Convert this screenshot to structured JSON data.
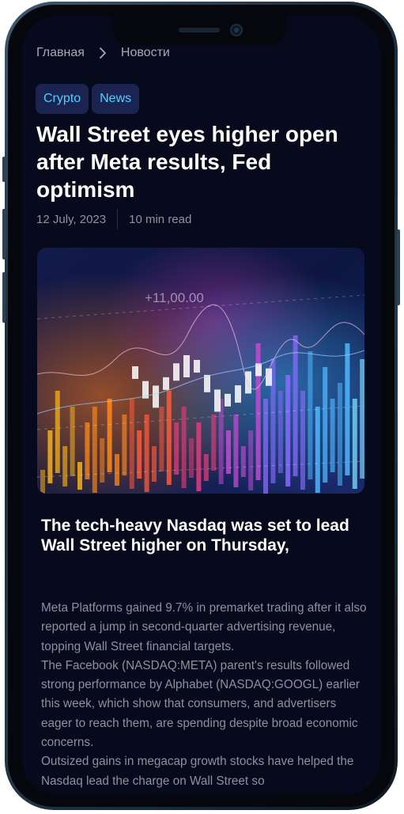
{
  "breadcrumb": {
    "home": "Главная",
    "current": "Новости"
  },
  "tags": [
    "Crypto",
    "News"
  ],
  "article": {
    "title": "Wall Street eyes higher open after Meta results, Fed optimism",
    "date": "12 July, 2023",
    "read_time": "10 min read",
    "image_overlay_text": "+11,00.00",
    "subtitle": "The tech-heavy Nasdaq was set to lead Wall Street higher on Thursday,",
    "paragraphs": [
      "Meta Platforms gained 9.7% in premarket trading after it also reported a jump in second-quarter advertising revenue, topping Wall Street financial targets.",
      "The Facebook (NASDAQ:META) parent's results followed strong performance by Alphabet (NASDAQ:GOOGL) earlier this week, which show that consumers, and advertisers eager to reach them, are spending despite broad economic concerns.",
      "Outsized gains in megacap growth stocks have helped the Nasdaq lead the charge on Wall Street so"
    ]
  },
  "icons": {
    "breadcrumb_separator": "chevron-right-icon"
  },
  "colors": {
    "background": "#070a1c",
    "tag_bg": "#1b2350",
    "tag_text": "#4dd2ff",
    "frame": "#1b2c3a"
  }
}
